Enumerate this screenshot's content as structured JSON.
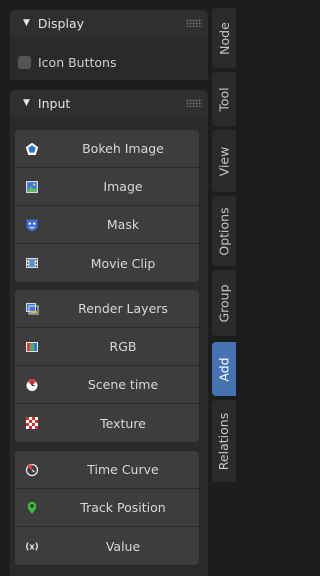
{
  "display": {
    "title": "Display",
    "icon_buttons_label": "Icon Buttons",
    "icon_buttons_checked": false
  },
  "input": {
    "title": "Input",
    "groups": [
      [
        {
          "label": "Bokeh Image",
          "icon": "bokeh-image-icon"
        },
        {
          "label": "Image",
          "icon": "image-icon"
        },
        {
          "label": "Mask",
          "icon": "mask-icon"
        },
        {
          "label": "Movie Clip",
          "icon": "movie-clip-icon"
        }
      ],
      [
        {
          "label": "Render Layers",
          "icon": "render-layers-icon"
        },
        {
          "label": "RGB",
          "icon": "rgb-icon"
        },
        {
          "label": "Scene time",
          "icon": "scene-time-icon"
        },
        {
          "label": "Texture",
          "icon": "texture-icon"
        }
      ],
      [
        {
          "label": "Time Curve",
          "icon": "time-curve-icon"
        },
        {
          "label": "Track Position",
          "icon": "track-position-icon"
        },
        {
          "label": "Value",
          "icon": "value-icon"
        }
      ]
    ]
  },
  "tabs": [
    {
      "label": "Node",
      "active": false
    },
    {
      "label": "Tool",
      "active": false
    },
    {
      "label": "View",
      "active": false
    },
    {
      "label": "Options",
      "active": false
    },
    {
      "label": "Group",
      "active": false
    },
    {
      "label": "Add",
      "active": true
    },
    {
      "label": "Relations",
      "active": false
    }
  ],
  "colors": {
    "accent": "#4772b3",
    "panel_bg": "#2a2a2a",
    "button_bg": "#3d3d3d"
  }
}
